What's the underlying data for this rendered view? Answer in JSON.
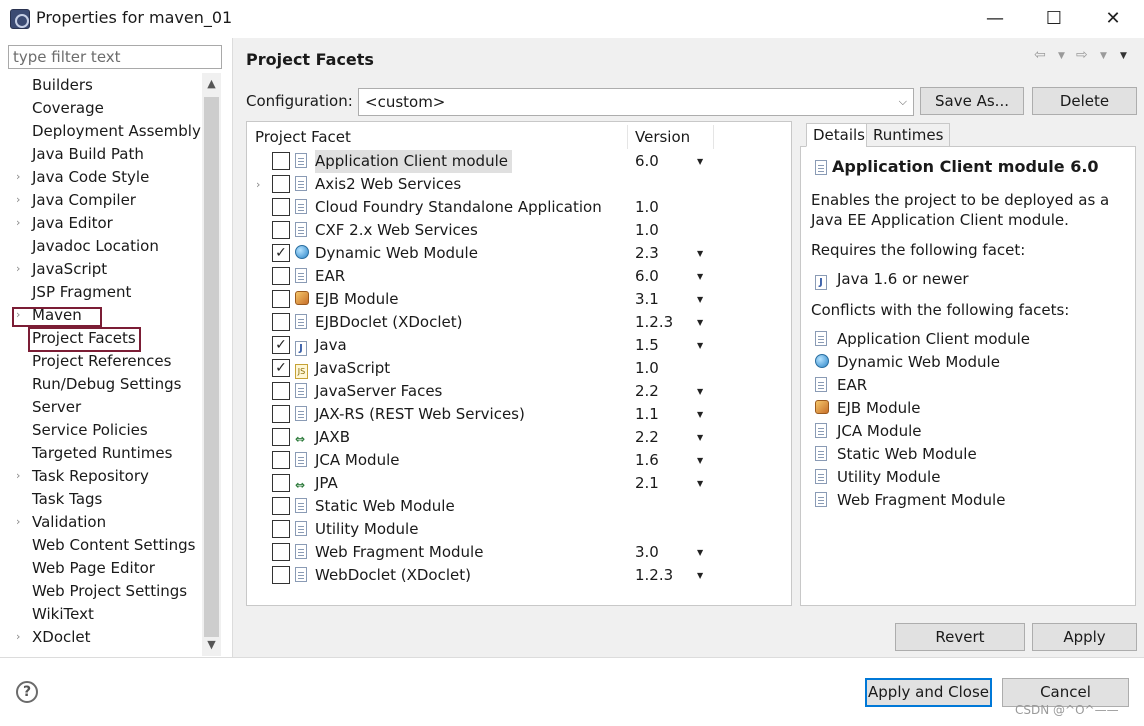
{
  "window": {
    "title": "Properties for maven_01",
    "minimize": "—",
    "maximize": "☐",
    "close": "✕"
  },
  "filter": {
    "placeholder": "type filter text"
  },
  "tree": {
    "items": [
      {
        "label": "Builders",
        "has_children": false
      },
      {
        "label": "Coverage",
        "has_children": false
      },
      {
        "label": "Deployment Assembly",
        "has_children": false
      },
      {
        "label": "Java Build Path",
        "has_children": false
      },
      {
        "label": "Java Code Style",
        "has_children": true
      },
      {
        "label": "Java Compiler",
        "has_children": true
      },
      {
        "label": "Java Editor",
        "has_children": true
      },
      {
        "label": "Javadoc Location",
        "has_children": false
      },
      {
        "label": "JavaScript",
        "has_children": true
      },
      {
        "label": "JSP Fragment",
        "has_children": false
      },
      {
        "label": "Maven",
        "has_children": true
      },
      {
        "label": "Project Facets",
        "has_children": false,
        "selected": true
      },
      {
        "label": "Project References",
        "has_children": false
      },
      {
        "label": "Run/Debug Settings",
        "has_children": false
      },
      {
        "label": "Server",
        "has_children": false
      },
      {
        "label": "Service Policies",
        "has_children": false
      },
      {
        "label": "Targeted Runtimes",
        "has_children": false
      },
      {
        "label": "Task Repository",
        "has_children": true
      },
      {
        "label": "Task Tags",
        "has_children": false
      },
      {
        "label": "Validation",
        "has_children": true
      },
      {
        "label": "Web Content Settings",
        "has_children": false
      },
      {
        "label": "Web Page Editor",
        "has_children": false
      },
      {
        "label": "Web Project Settings",
        "has_children": false
      },
      {
        "label": "WikiText",
        "has_children": false
      },
      {
        "label": "XDoclet",
        "has_children": true
      }
    ]
  },
  "page": {
    "title": "Project Facets",
    "config_label": "Configuration:",
    "config_value": "<custom>",
    "save_as": "Save As...",
    "delete": "Delete"
  },
  "facets": {
    "headers": {
      "name": "Project Facet",
      "version": "Version"
    },
    "rows": [
      {
        "name": "Application Client module",
        "version": "6.0",
        "checked": false,
        "dropdown": true,
        "icon": "doc-icon",
        "selected": true
      },
      {
        "name": "Axis2 Web Services",
        "version": "",
        "checked": false,
        "dropdown": false,
        "icon": "doc-icon",
        "expandable": true
      },
      {
        "name": "Cloud Foundry Standalone Application",
        "version": "1.0",
        "checked": false,
        "dropdown": false,
        "icon": "doc-icon"
      },
      {
        "name": "CXF 2.x Web Services",
        "version": "1.0",
        "checked": false,
        "dropdown": false,
        "icon": "doc-icon"
      },
      {
        "name": "Dynamic Web Module",
        "version": "2.3",
        "checked": true,
        "dropdown": true,
        "icon": "web-icon"
      },
      {
        "name": "EAR",
        "version": "6.0",
        "checked": false,
        "dropdown": true,
        "icon": "doc-icon"
      },
      {
        "name": "EJB Module",
        "version": "3.1",
        "checked": false,
        "dropdown": true,
        "icon": "ejb-icon"
      },
      {
        "name": "EJBDoclet (XDoclet)",
        "version": "1.2.3",
        "checked": false,
        "dropdown": true,
        "icon": "doc-icon"
      },
      {
        "name": "Java",
        "version": "1.5",
        "checked": true,
        "dropdown": true,
        "icon": "java-icon"
      },
      {
        "name": "JavaScript",
        "version": "1.0",
        "checked": true,
        "dropdown": false,
        "icon": "javascript-icon"
      },
      {
        "name": "JavaServer Faces",
        "version": "2.2",
        "checked": false,
        "dropdown": true,
        "icon": "doc-icon"
      },
      {
        "name": "JAX-RS (REST Web Services)",
        "version": "1.1",
        "checked": false,
        "dropdown": true,
        "icon": "doc-icon"
      },
      {
        "name": "JAXB",
        "version": "2.2",
        "checked": false,
        "dropdown": true,
        "icon": "webservice-icon"
      },
      {
        "name": "JCA Module",
        "version": "1.6",
        "checked": false,
        "dropdown": true,
        "icon": "doc-icon"
      },
      {
        "name": "JPA",
        "version": "2.1",
        "checked": false,
        "dropdown": true,
        "icon": "webservice-icon"
      },
      {
        "name": "Static Web Module",
        "version": "",
        "checked": false,
        "dropdown": false,
        "icon": "doc-icon"
      },
      {
        "name": "Utility Module",
        "version": "",
        "checked": false,
        "dropdown": false,
        "icon": "doc-icon"
      },
      {
        "name": "Web Fragment Module",
        "version": "3.0",
        "checked": false,
        "dropdown": true,
        "icon": "doc-icon"
      },
      {
        "name": "WebDoclet (XDoclet)",
        "version": "1.2.3",
        "checked": false,
        "dropdown": true,
        "icon": "doc-icon"
      }
    ]
  },
  "details": {
    "tabs": [
      "Details",
      "Runtimes"
    ],
    "title": "Application Client module 6.0",
    "description_line1": "Enables the project to be deployed as a",
    "description_line2": "Java EE Application Client module.",
    "requires_label": "Requires the following facet:",
    "requires": [
      {
        "name": "Java 1.6 or newer",
        "icon": "java-icon"
      }
    ],
    "conflicts_label": "Conflicts with the following facets:",
    "conflicts": [
      {
        "name": "Application Client module",
        "icon": "doc-icon"
      },
      {
        "name": "Dynamic Web Module",
        "icon": "web-icon"
      },
      {
        "name": "EAR",
        "icon": "doc-icon"
      },
      {
        "name": "EJB Module",
        "icon": "ejb-icon"
      },
      {
        "name": "JCA Module",
        "icon": "doc-icon"
      },
      {
        "name": "Static Web Module",
        "icon": "doc-icon"
      },
      {
        "name": "Utility Module",
        "icon": "doc-icon"
      },
      {
        "name": "Web Fragment Module",
        "icon": "doc-icon"
      }
    ]
  },
  "buttons": {
    "revert": "Revert",
    "apply": "Apply",
    "apply_close": "Apply and Close",
    "cancel": "Cancel",
    "help": "?"
  },
  "watermark": "CSDN @^O^——",
  "colors": {
    "highlight_border": "#7b1d35",
    "default_button_border": "#0078d7"
  }
}
